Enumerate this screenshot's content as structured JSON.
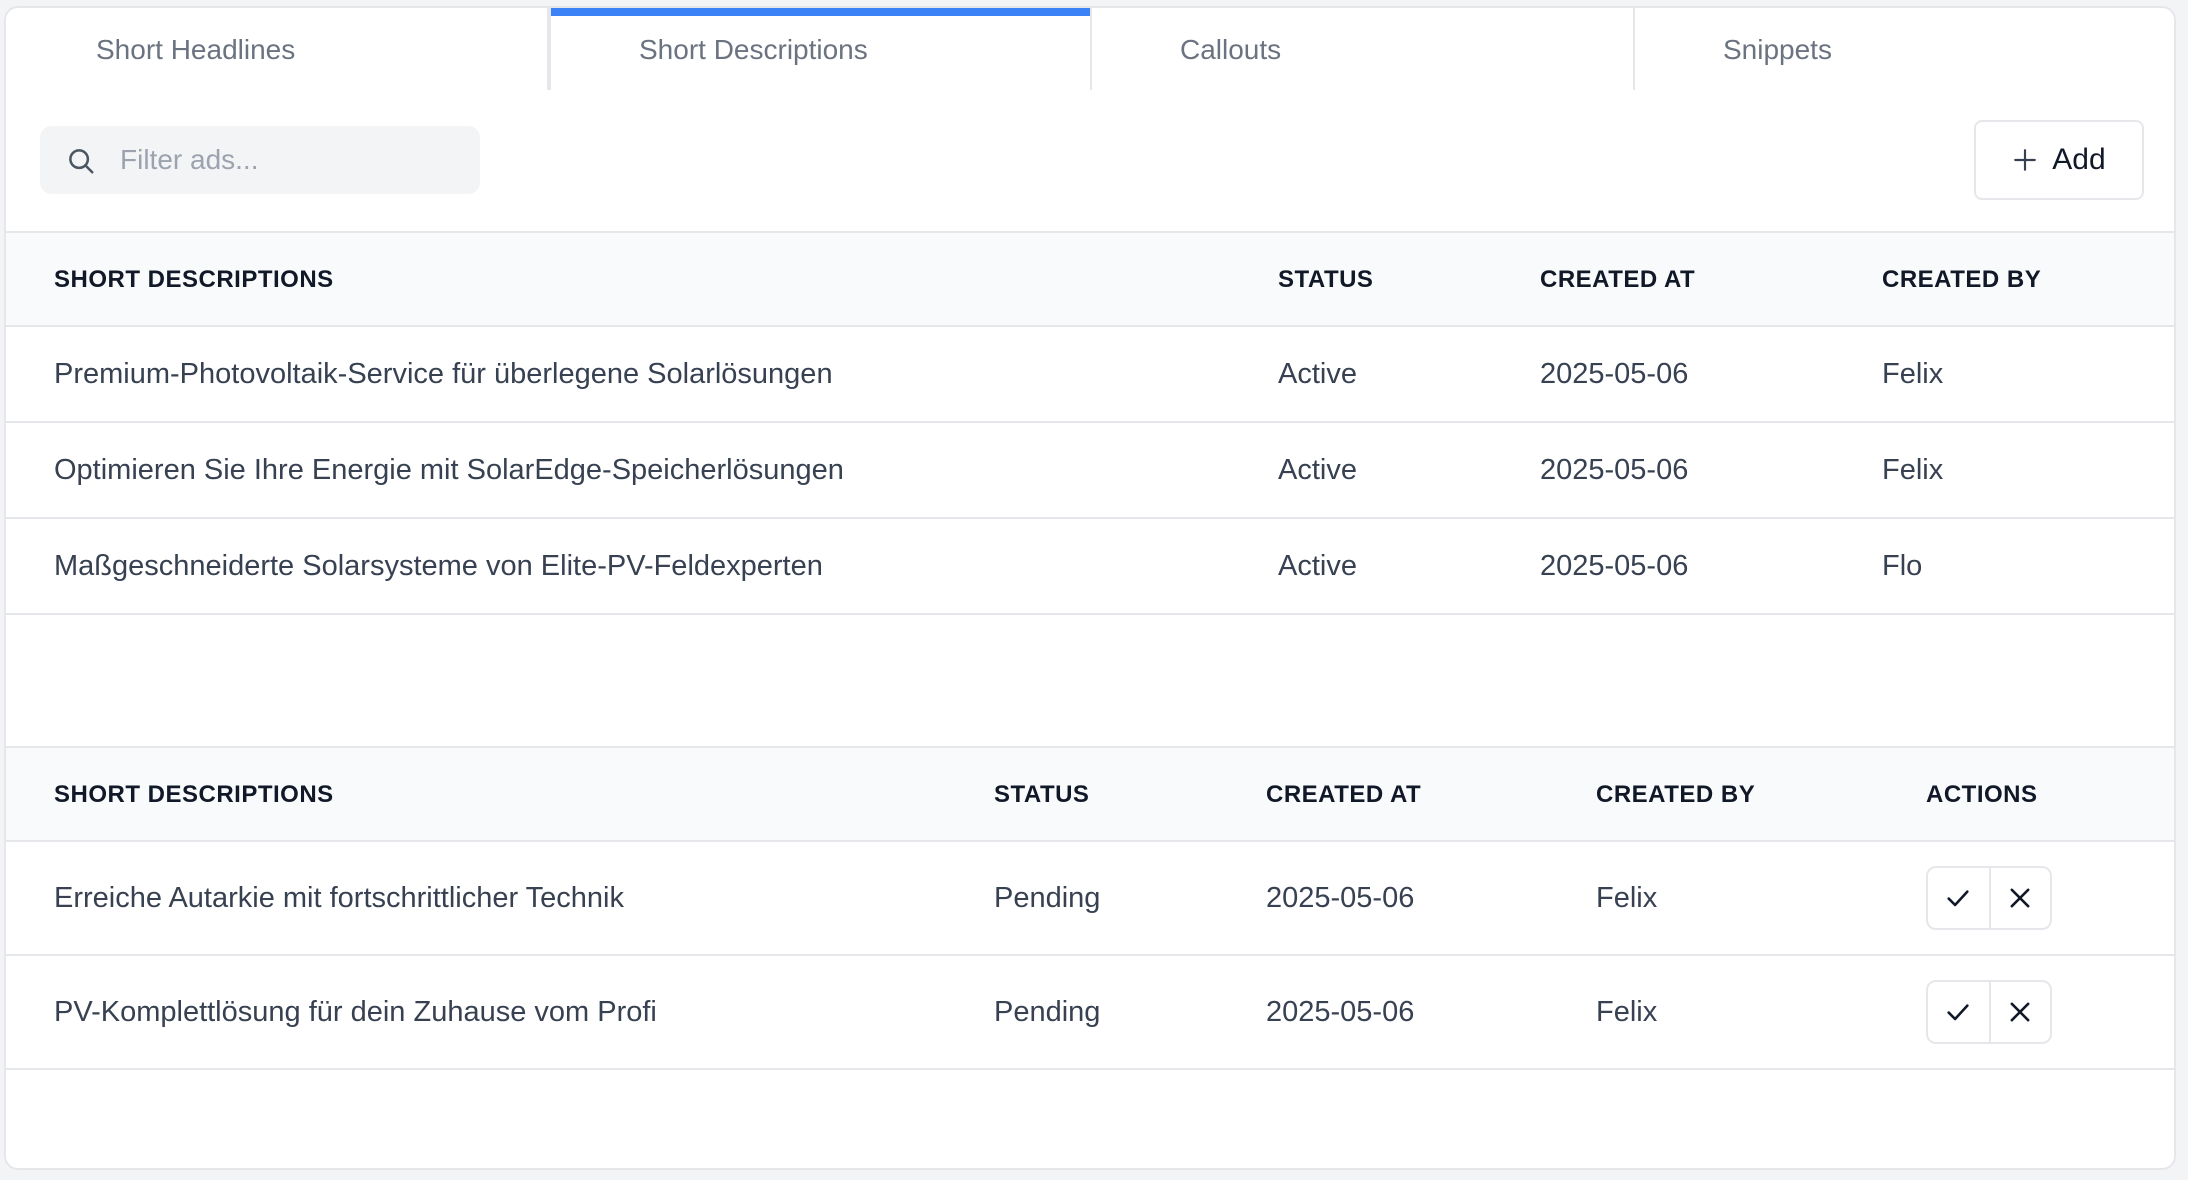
{
  "tabs": [
    {
      "label": "Short Headlines",
      "active": false
    },
    {
      "label": "Short Descriptions",
      "active": true
    },
    {
      "label": "Callouts",
      "active": false
    },
    {
      "label": "Snippets",
      "active": false
    }
  ],
  "toolbar": {
    "search_placeholder": "Filter ads...",
    "search_icon": "search-icon",
    "add_label": "Add",
    "add_icon": "plus-icon"
  },
  "active_table": {
    "headers": [
      "SHORT DESCRIPTIONS",
      "STATUS",
      "CREATED AT",
      "CREATED BY"
    ],
    "rows": [
      {
        "text": "Premium-Photovoltaik-Service für überlegene Solarlösungen",
        "status": "Active",
        "created_at": "2025-05-06",
        "created_by": "Felix"
      },
      {
        "text": "Optimieren Sie Ihre Energie mit SolarEdge-Speicherlösungen",
        "status": "Active",
        "created_at": "2025-05-06",
        "created_by": "Felix"
      },
      {
        "text": "Maßgeschneiderte Solarsysteme von Elite-PV-Feldexperten",
        "status": "Active",
        "created_at": "2025-05-06",
        "created_by": "Flo"
      }
    ]
  },
  "pending_table": {
    "headers": [
      "SHORT DESCRIPTIONS",
      "STATUS",
      "CREATED AT",
      "CREATED BY",
      "ACTIONS"
    ],
    "rows": [
      {
        "text": "Erreiche Autarkie mit fortschrittlicher Technik",
        "status": "Pending",
        "created_at": "2025-05-06",
        "created_by": "Felix",
        "actions": [
          "check-icon",
          "close-icon"
        ]
      },
      {
        "text": "PV-Komplettlösung für dein Zuhause vom Profi",
        "status": "Pending",
        "created_at": "2025-05-06",
        "created_by": "Felix",
        "actions": [
          "check-icon",
          "close-icon"
        ]
      }
    ]
  },
  "colors": {
    "accent": "#3b82f6",
    "border": "#e5e7eb",
    "header_bg": "#f9fafb",
    "search_bg": "#f3f4f6"
  }
}
